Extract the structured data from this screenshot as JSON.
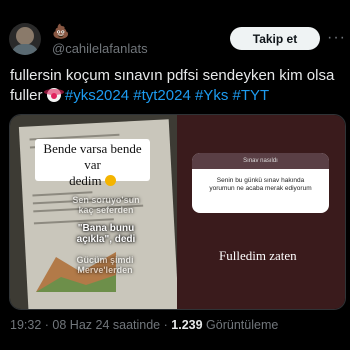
{
  "author": {
    "handle": "@cahilelafanlats",
    "name_icon": "pile-of-poo-emoji-icon",
    "follow_label": "Takip et",
    "more_label": "···"
  },
  "tweet": {
    "text": "fullersin koçum sınavın pdfsi sendeykenkim olsa fuller",
    "line1": "fullersin koçum sınavın pdfsi sendeyken kim olsa",
    "line2_prefix": "fuller ",
    "hashtags": [
      "#yks2024",
      "#tyt2024",
      "#Yks",
      "#TYT"
    ]
  },
  "media": {
    "left": {
      "caption_line1": "Bende varsa bende var",
      "caption_line2": "dedim",
      "overlay_1": "Sen soruyo'sun kaç seferden",
      "overlay_2": "\"Bana bunu açıkla\", dedi",
      "overlay_3": "Gücüm şimdi Merve'lerden"
    },
    "right": {
      "card_title": "Sınav nasıldı",
      "card_line1": "Senin bu günkü sınav hakında",
      "card_line2": "yorumun ne acaba merak ediyorum",
      "caption": "Fulledim zaten"
    }
  },
  "meta": {
    "time": "19:32",
    "sep1": "·",
    "date": "08 Haz 24 saatinde",
    "sep2": "·",
    "views": "1.239",
    "views_label": "Görüntüleme"
  },
  "colors": {
    "hashtag": "#1d9bf0",
    "secondary": "#71767b",
    "background": "#000000"
  }
}
